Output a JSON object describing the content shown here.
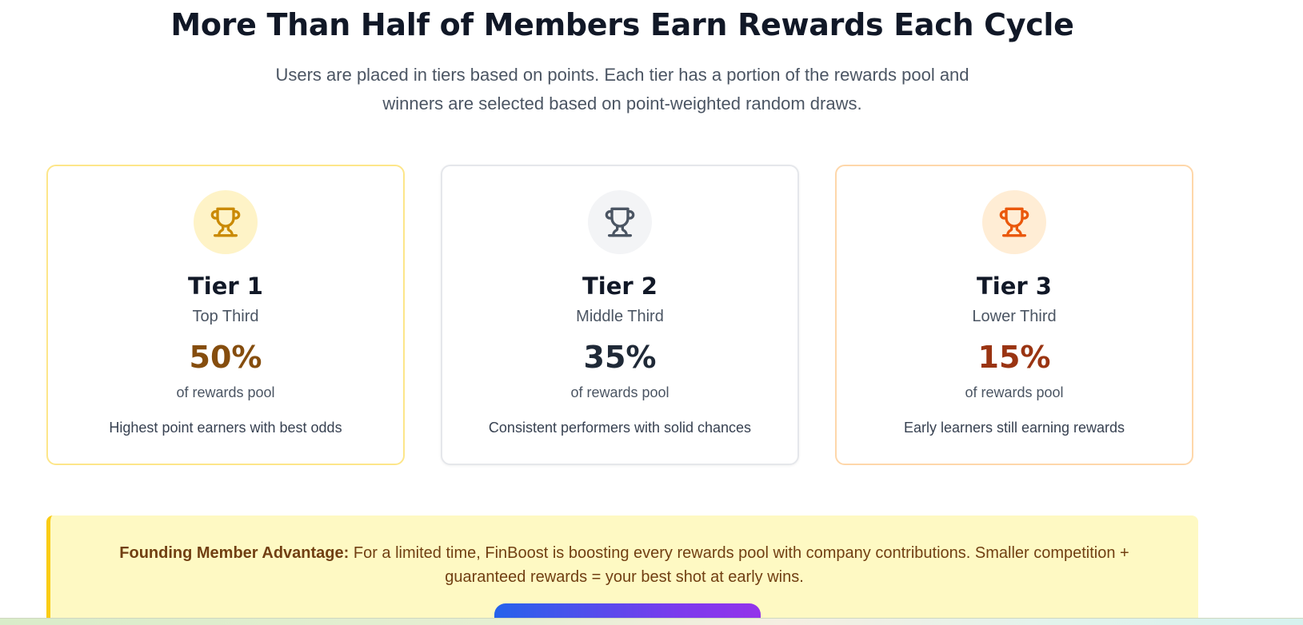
{
  "header": {
    "title": "More Than Half of Members Earn Rewards Each Cycle",
    "subtitle_line1": "Users are placed in tiers based on points. Each tier has a portion of the rewards pool and",
    "subtitle_line2": "winners are selected based on point-weighted random draws."
  },
  "tiers": [
    {
      "name": "Tier 1",
      "range": "Top Third",
      "percent": "50%",
      "pool_label": "of rewards pool",
      "description": "Highest point earners with best odds",
      "icon": "trophy-icon",
      "accent": "#ca8a04"
    },
    {
      "name": "Tier 2",
      "range": "Middle Third",
      "percent": "35%",
      "pool_label": "of rewards pool",
      "description": "Consistent performers with solid chances",
      "icon": "trophy-icon",
      "accent": "#4b5563"
    },
    {
      "name": "Tier 3",
      "range": "Lower Third",
      "percent": "15%",
      "pool_label": "of rewards pool",
      "description": "Early learners still earning rewards",
      "icon": "trophy-icon",
      "accent": "#ea580c"
    }
  ],
  "banner": {
    "strong": "Founding Member Advantage:",
    "text": " For a limited time, FinBoost is boosting every rewards pool with company contributions. Smaller competition + guaranteed rewards = your best shot at early wins."
  },
  "colors": {
    "heading": "#111827",
    "banner_bg": "#fef9c3",
    "banner_border": "#facc15",
    "button_gradient_start": "#2563eb",
    "button_gradient_end": "#9333ea"
  }
}
